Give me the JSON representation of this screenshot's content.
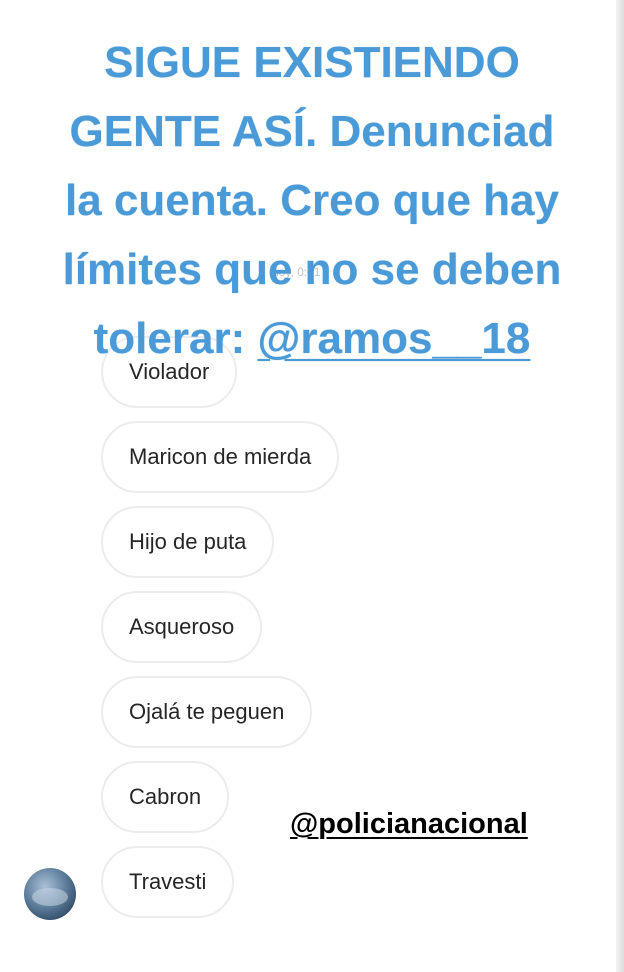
{
  "story": {
    "lines": [
      "SIGUE EXISTIENDO",
      "GENTE ASÍ. Denunciad",
      "la cuenta. Creo que hay",
      "límites que no se deben",
      "tolerar: "
    ],
    "mention": "@ramos__18",
    "text_color": "#4a9ad8"
  },
  "timestamp": "hoy, 0:01",
  "messages": [
    "Violador",
    "Maricon de mierda",
    "Hijo de puta",
    "Asqueroso",
    "Ojalá te peguen",
    "Cabron",
    "Travesti"
  ],
  "overlay_mention": "@policianacional",
  "avatar_icon": "profile-photo"
}
